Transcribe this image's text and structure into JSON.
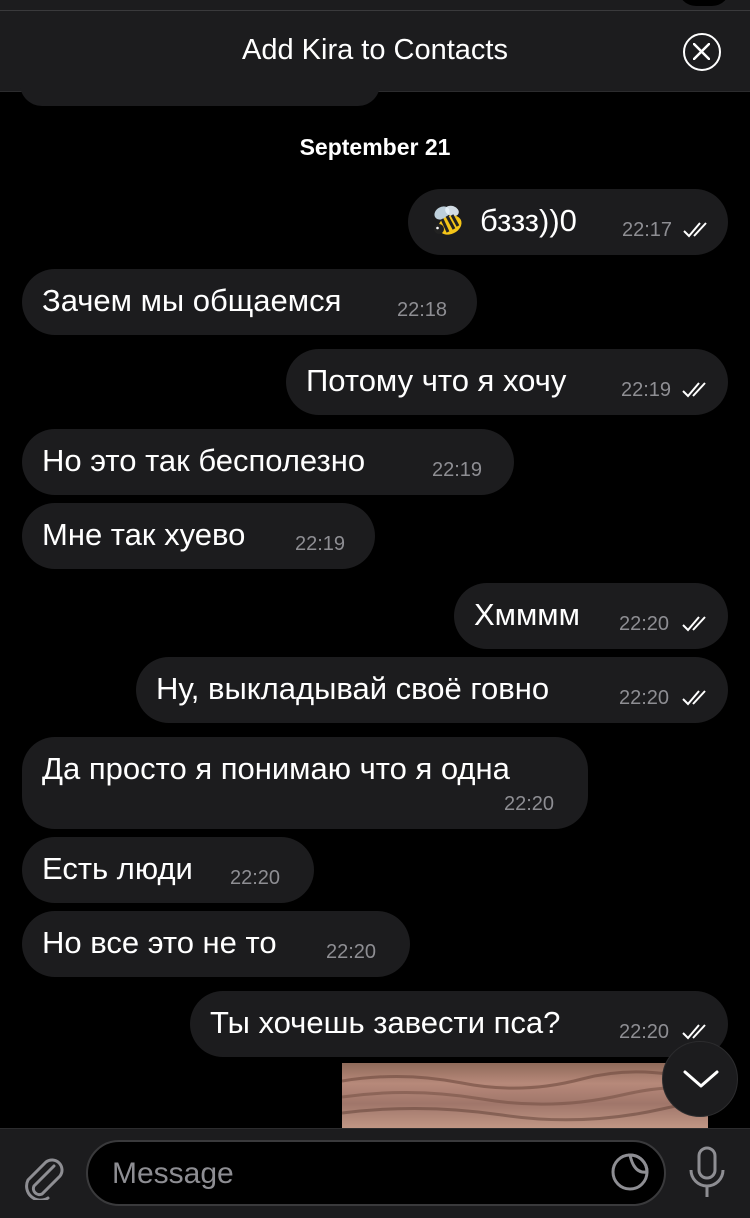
{
  "header": {
    "add_contact_label": "Add Kira to Contacts"
  },
  "date_divider": "September 21",
  "messages": [
    {
      "direction": "out",
      "text": "бззз))0",
      "time": "22:17",
      "emoji": "bee-icon",
      "read": true
    },
    {
      "direction": "in",
      "text": "Зачем мы общаемся",
      "time": "22:18"
    },
    {
      "direction": "out",
      "text": "Потому что я хочу",
      "time": "22:19",
      "read": true
    },
    {
      "direction": "in",
      "text": "Но это так бесполезно",
      "time": "22:19"
    },
    {
      "direction": "in",
      "text": "Мне так хуево",
      "time": "22:19"
    },
    {
      "direction": "out",
      "text": "Хмммм",
      "time": "22:20",
      "read": true
    },
    {
      "direction": "out",
      "text": "Ну, выкладывай своё говно",
      "time": "22:20",
      "read": true
    },
    {
      "direction": "in",
      "text": "Да просто я понимаю что я одна",
      "time": "22:20"
    },
    {
      "direction": "in",
      "text": "Есть люди",
      "time": "22:20"
    },
    {
      "direction": "in",
      "text": "Но все это не то",
      "time": "22:20"
    },
    {
      "direction": "out",
      "text": "Ты хочешь завести пса?",
      "time": "22:20",
      "read": true
    }
  ],
  "composer": {
    "placeholder": "Message"
  },
  "icons": {
    "close": "close-circle-icon",
    "attach": "paperclip-icon",
    "sticker": "sticker-icon",
    "mic": "microphone-icon",
    "scroll": "chevron-down-icon",
    "read_status": "double-check-icon"
  },
  "colors": {
    "background": "#000000",
    "bubble": "#1c1c1e",
    "text": "#ffffff",
    "meta": "#8e8e93"
  }
}
